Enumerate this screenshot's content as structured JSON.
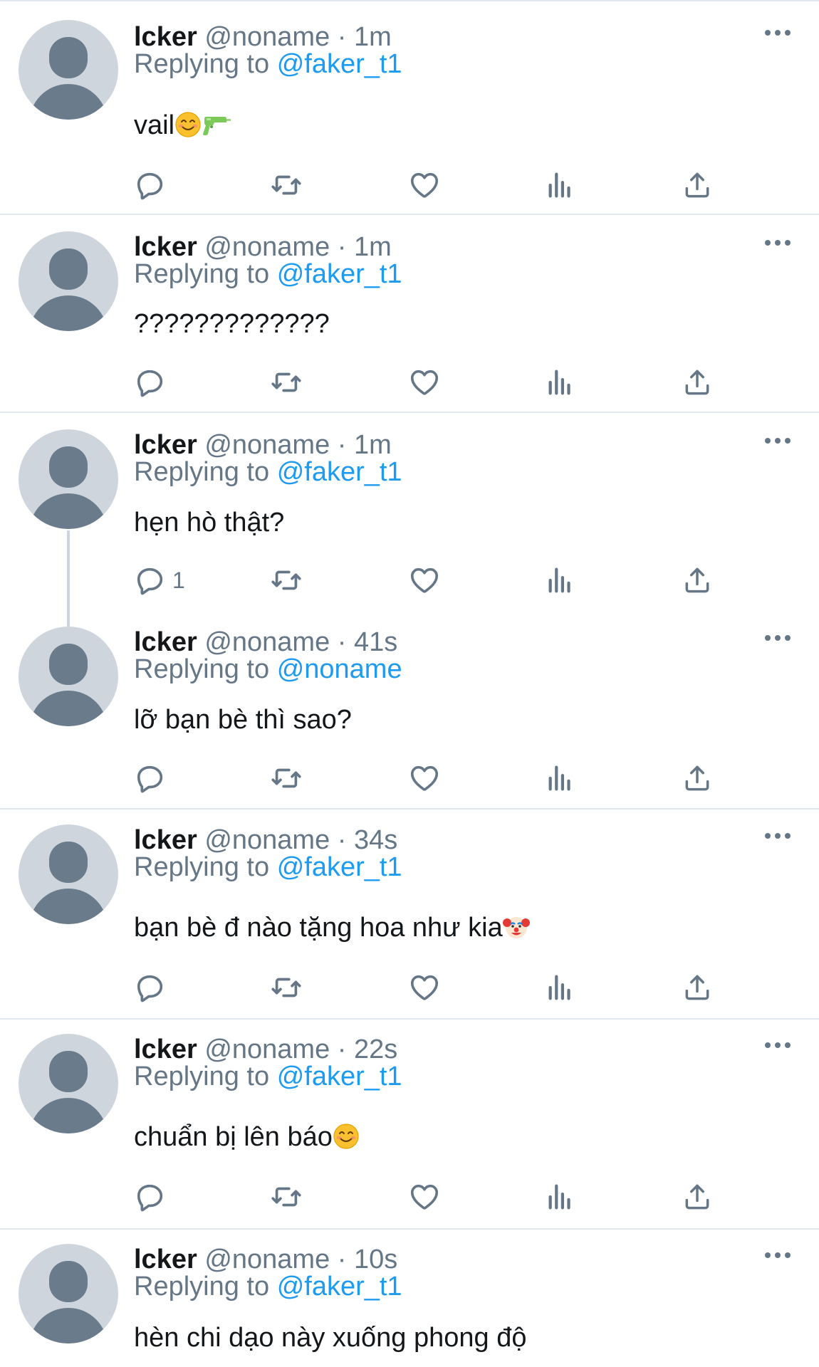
{
  "tweets": [
    {
      "name": "lcker",
      "handle": "@noname",
      "sep": "·",
      "time": "1m",
      "replying_prefix": "Replying to",
      "replying_to": "@faker_t1",
      "text": "vail",
      "emojis": [
        "smiling-face-emoji",
        "water-pistol-emoji"
      ],
      "reply_count": ""
    },
    {
      "name": "lcker",
      "handle": "@noname",
      "sep": "·",
      "time": "1m",
      "replying_prefix": "Replying to",
      "replying_to": "@faker_t1",
      "text": "?????????????",
      "emojis": [],
      "reply_count": ""
    },
    {
      "name": "lcker",
      "handle": "@noname",
      "sep": "·",
      "time": "1m",
      "replying_prefix": "Replying to",
      "replying_to": "@faker_t1",
      "text": "hẹn hò thật?",
      "emojis": [],
      "reply_count": "1"
    },
    {
      "name": "lcker",
      "handle": "@noname",
      "sep": "·",
      "time": "41s",
      "replying_prefix": "Replying to",
      "replying_to": "@noname",
      "text": "lỡ bạn bè thì sao?",
      "emojis": [],
      "reply_count": ""
    },
    {
      "name": "lcker",
      "handle": "@noname",
      "sep": "·",
      "time": "34s",
      "replying_prefix": "Replying to",
      "replying_to": "@faker_t1",
      "text": "bạn bè đ nào tặng hoa như kia",
      "emojis": [
        "clown-face-emoji"
      ],
      "reply_count": ""
    },
    {
      "name": "lcker",
      "handle": "@noname",
      "sep": "·",
      "time": "22s",
      "replying_prefix": "Replying to",
      "replying_to": "@faker_t1",
      "text": "chuẩn bị lên báo",
      "emojis": [
        "smiling-face-emoji"
      ],
      "reply_count": ""
    },
    {
      "name": "lcker",
      "handle": "@noname",
      "sep": "·",
      "time": "10s",
      "replying_prefix": "Replying to",
      "replying_to": "@faker_t1",
      "text": "hèn chi dạo này xuống phong độ",
      "emojis": [],
      "reply_count": ""
    }
  ],
  "icons": {
    "reply": "reply-icon",
    "retweet": "retweet-icon",
    "like": "like-icon",
    "views": "views-icon",
    "share": "share-icon",
    "more": "more-options-icon"
  },
  "colors": {
    "background": "#ffffff",
    "text": "#14171a",
    "secondary": "#657786",
    "link": "#1d9bf0",
    "divider": "#e1e8ed",
    "avatar_bg": "#ced5dc",
    "avatar_fg": "#6a7b8b"
  }
}
